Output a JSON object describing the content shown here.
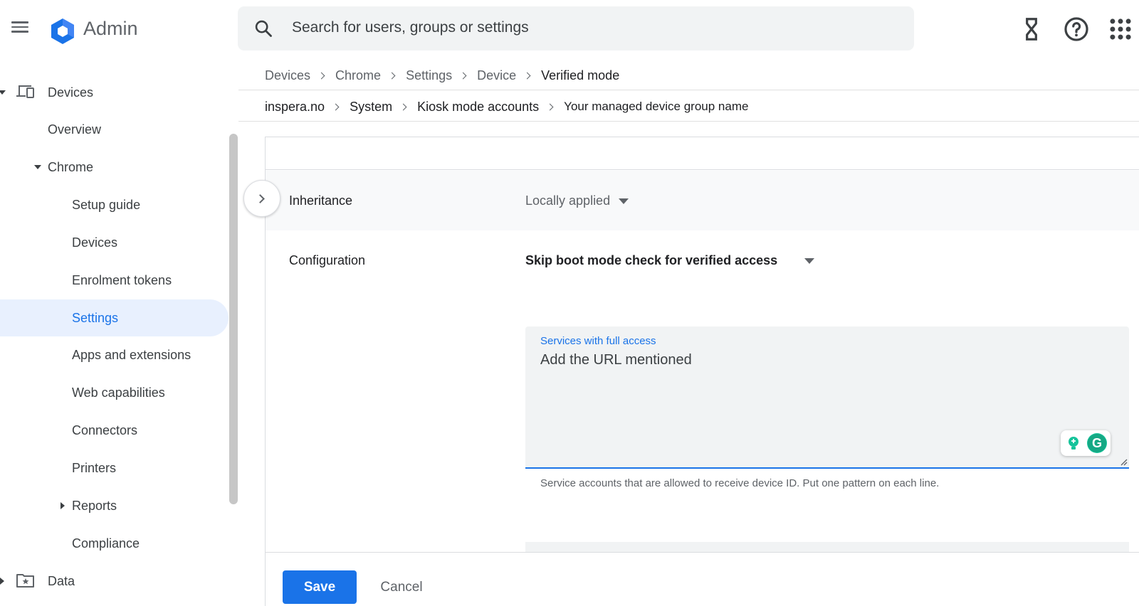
{
  "header": {
    "app_name": "Admin",
    "search_placeholder": "Search for users, groups or settings",
    "icons": [
      "menu-icon",
      "admin-logo-icon",
      "search-icon",
      "hourglass-icon",
      "help-icon",
      "apps-grid-icon"
    ]
  },
  "sidebar": {
    "devices": "Devices",
    "overview": "Overview",
    "chrome": "Chrome",
    "setup_guide": "Setup guide",
    "chrome_devices": "Devices",
    "enrolment_tokens": "Enrolment tokens",
    "settings": "Settings",
    "apps_extensions": "Apps and extensions",
    "web_capabilities": "Web capabilities",
    "connectors": "Connectors",
    "printers": "Printers",
    "reports": "Reports",
    "compliance": "Compliance",
    "data": "Data"
  },
  "breadcrumbs": {
    "path": [
      "Devices",
      "Chrome",
      "Settings",
      "Device",
      "Verified mode"
    ],
    "org_path": [
      "inspera.no",
      "System",
      "Kiosk mode accounts",
      "Your managed device group name"
    ]
  },
  "setting": {
    "inheritance_label": "Inheritance",
    "inheritance_value": "Locally applied",
    "configuration_label": "Configuration",
    "configuration_value": "Skip boot mode check for verified access",
    "field_label": "Services with full access",
    "field_value": "Add the URL mentioned",
    "helper_text": "Service accounts that are allowed to receive device ID. Put one pattern on each line."
  },
  "footer": {
    "save": "Save",
    "cancel": "Cancel"
  },
  "colors": {
    "accent": "#1a73e8",
    "active_bg": "#e8f0fe",
    "grammarly": "#15c39a"
  }
}
